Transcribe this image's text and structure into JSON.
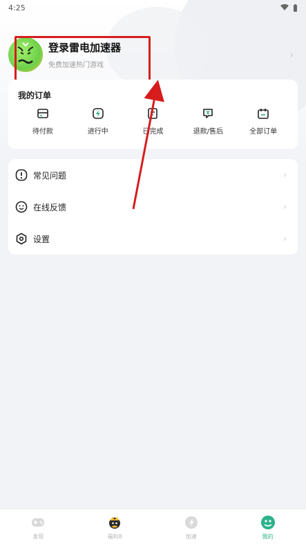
{
  "status_bar": {
    "time": "4:25"
  },
  "profile": {
    "title": "登录雷电加速器",
    "subtitle": "免费加速热门游戏"
  },
  "orders": {
    "title": "我的订单",
    "items": [
      {
        "label": "待付款",
        "icon": "card-icon"
      },
      {
        "label": "进行中",
        "icon": "bolt-icon"
      },
      {
        "label": "已完成",
        "icon": "check-doc-icon"
      },
      {
        "label": "退款/售后",
        "icon": "refund-icon"
      },
      {
        "label": "全部订单",
        "icon": "calendar-icon"
      }
    ]
  },
  "menu": {
    "items": [
      {
        "label": "常见问题",
        "icon": "question-icon"
      },
      {
        "label": "在线反馈",
        "icon": "feedback-icon"
      },
      {
        "label": "设置",
        "icon": "settings-icon"
      }
    ]
  },
  "bottom_nav": {
    "items": [
      {
        "label": "发现",
        "icon": "gamepad-icon"
      },
      {
        "label": "福利8",
        "icon": "mascot-icon"
      },
      {
        "label": "加速",
        "icon": "rocket-icon"
      },
      {
        "label": "我的",
        "icon": "profile-icon"
      }
    ],
    "active_index": 3
  },
  "colors": {
    "accent": "#2db38a",
    "highlight": "#d61c1c",
    "background": "#f2f3f7"
  }
}
